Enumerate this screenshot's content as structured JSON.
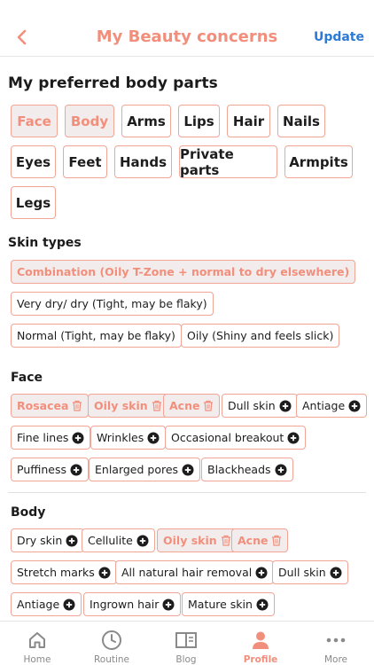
{
  "header": {
    "title": "My Beauty concerns",
    "update_label": "Update"
  },
  "body_parts": {
    "title": "My preferred body parts",
    "items": [
      {
        "label": "Face",
        "selected": true
      },
      {
        "label": "Body",
        "selected": true
      },
      {
        "label": "Arms",
        "selected": false
      },
      {
        "label": "Lips",
        "selected": false
      },
      {
        "label": "Hair",
        "selected": false
      },
      {
        "label": "Nails",
        "selected": false
      },
      {
        "label": "Eyes",
        "selected": false
      },
      {
        "label": "Feet",
        "selected": false
      },
      {
        "label": "Hands",
        "selected": false
      },
      {
        "label": "Private parts",
        "selected": false
      },
      {
        "label": "Armpits",
        "selected": false
      },
      {
        "label": "Legs",
        "selected": false
      }
    ]
  },
  "skin_types": {
    "title": "Skin types",
    "items": [
      {
        "label": "Combination (Oily T-Zone + normal to dry elsewhere)",
        "selected": true
      },
      {
        "label": "Very dry/ dry (Tight, may be flaky)",
        "selected": false
      },
      {
        "label": "Normal (Tight, may be flaky)",
        "selected": false
      },
      {
        "label": "Oily (Shiny and feels slick)",
        "selected": false
      }
    ]
  },
  "face": {
    "title": "Face",
    "items": [
      {
        "label": "Rosacea",
        "selected": true,
        "icon": "trash-icon"
      },
      {
        "label": "Oily skin",
        "selected": true,
        "icon": "trash-icon"
      },
      {
        "label": "Acne",
        "selected": true,
        "icon": "trash-icon"
      },
      {
        "label": "Dull skin",
        "selected": false,
        "icon": "plus-circle-icon"
      },
      {
        "label": "Antiage",
        "selected": false,
        "icon": "plus-circle-icon"
      },
      {
        "label": "Fine lines",
        "selected": false,
        "icon": "plus-circle-icon"
      },
      {
        "label": "Wrinkles",
        "selected": false,
        "icon": "plus-circle-icon"
      },
      {
        "label": "Occasional breakout",
        "selected": false,
        "icon": "plus-circle-icon"
      },
      {
        "label": "Puffiness",
        "selected": false,
        "icon": "plus-circle-icon"
      },
      {
        "label": "Enlarged pores",
        "selected": false,
        "icon": "plus-circle-icon"
      },
      {
        "label": "Blackheads",
        "selected": false,
        "icon": "plus-circle-icon"
      }
    ]
  },
  "body": {
    "title": "Body",
    "items": [
      {
        "label": "Dry skin",
        "selected": false,
        "icon": "plus-circle-icon"
      },
      {
        "label": "Cellulite",
        "selected": false,
        "icon": "plus-circle-icon"
      },
      {
        "label": "Oily skin",
        "selected": true,
        "icon": "trash-icon"
      },
      {
        "label": "Acne",
        "selected": true,
        "icon": "trash-icon"
      },
      {
        "label": "Stretch marks",
        "selected": false,
        "icon": "plus-circle-icon"
      },
      {
        "label": "All natural hair removal",
        "selected": false,
        "icon": "plus-circle-icon"
      },
      {
        "label": "Dull skin",
        "selected": false,
        "icon": "plus-circle-icon"
      },
      {
        "label": "Antiage",
        "selected": false,
        "icon": "plus-circle-icon"
      },
      {
        "label": "Ingrown hair",
        "selected": false,
        "icon": "plus-circle-icon"
      },
      {
        "label": "Mature skin",
        "selected": false,
        "icon": "plus-circle-icon"
      }
    ]
  },
  "tabbar": {
    "items": [
      {
        "label": "Home",
        "icon": "home-icon",
        "active": false
      },
      {
        "label": "Routine",
        "icon": "clock-icon",
        "active": false
      },
      {
        "label": "Blog",
        "icon": "book-icon",
        "active": false
      },
      {
        "label": "Profile",
        "icon": "person-icon",
        "active": true
      },
      {
        "label": "More",
        "icon": "more-icon",
        "active": false
      }
    ]
  },
  "colors": {
    "accent": "#f28f7c",
    "link": "#2d7ad6",
    "selected_bg": "#f3ecec",
    "border": "#f2a497"
  }
}
